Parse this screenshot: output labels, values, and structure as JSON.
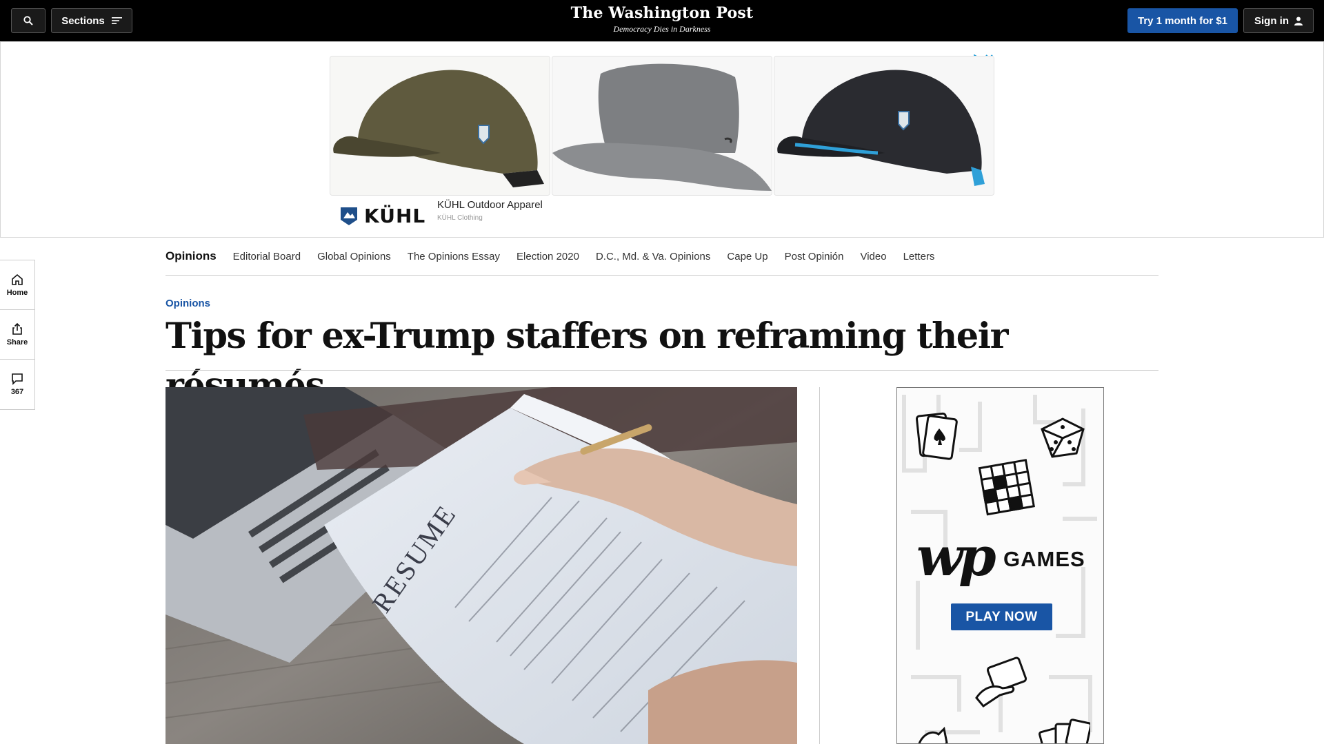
{
  "header": {
    "sections_label": "Sections",
    "logo": "The Washington Post",
    "tagline": "Democracy Dies in Darkness",
    "subscribe_label": "Try 1 month for $1",
    "signin_label": "Sign in"
  },
  "ad": {
    "brand_wordmark": "KÜHL",
    "title": "KÜHL Outdoor Apparel",
    "subtitle": "KÜHL Clothing"
  },
  "rail": {
    "home_label": "Home",
    "share_label": "Share",
    "comments_count": "367"
  },
  "opinions_nav": {
    "items": [
      "Opinions",
      "Editorial Board",
      "Global Opinions",
      "The Opinions Essay",
      "Election 2020",
      "D.C., Md. & Va. Opinions",
      "Cape Up",
      "Post Opinión",
      "Video",
      "Letters"
    ]
  },
  "article": {
    "kicker": "Opinions",
    "headline": "Tips for ex-Trump staffers on reframing their résumés",
    "image_text": "RESUME"
  },
  "games_ad": {
    "logo": "wp",
    "word": "GAMES",
    "cta": "PLAY NOW"
  },
  "colors": {
    "accent_blue": "#1955a5",
    "ad_blue": "#1a9ad6"
  }
}
